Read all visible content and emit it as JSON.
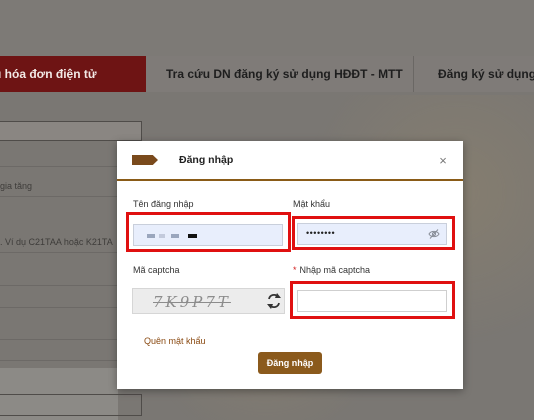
{
  "background": {
    "tabs": [
      {
        "label": "u hóa đơn điện tử",
        "active": true
      },
      {
        "label": "Tra cứu DN đăng ký sử dụng HĐĐT - MTT",
        "active": false
      },
      {
        "label": "Đăng ký sử dụng h",
        "active": false
      }
    ],
    "field_hints": [
      "gia tăng",
      ". Ví dụ C21TAA hoặc K21TA"
    ]
  },
  "modal": {
    "title": "Đăng nhập",
    "close_symbol": "×",
    "username": {
      "label": "Tên đăng nhập"
    },
    "password": {
      "label": "Mật khẩu",
      "value": "••••••••"
    },
    "captcha": {
      "label": "Mã captcha",
      "image_text": "7K9P7T"
    },
    "captcha_input": {
      "required_mark": "*",
      "label": "Nhập mã captcha",
      "value": ""
    },
    "forgot_password": "Quên mật khẩu",
    "submit_label": "Đăng nhập"
  },
  "colors": {
    "accent_brown": "#8b5a1c",
    "highlight_red": "#e01010",
    "active_tab": "#6e1414"
  },
  "icons": [
    "close-icon",
    "eye-slash-icon",
    "refresh-icon",
    "arrow-tag-icon"
  ]
}
